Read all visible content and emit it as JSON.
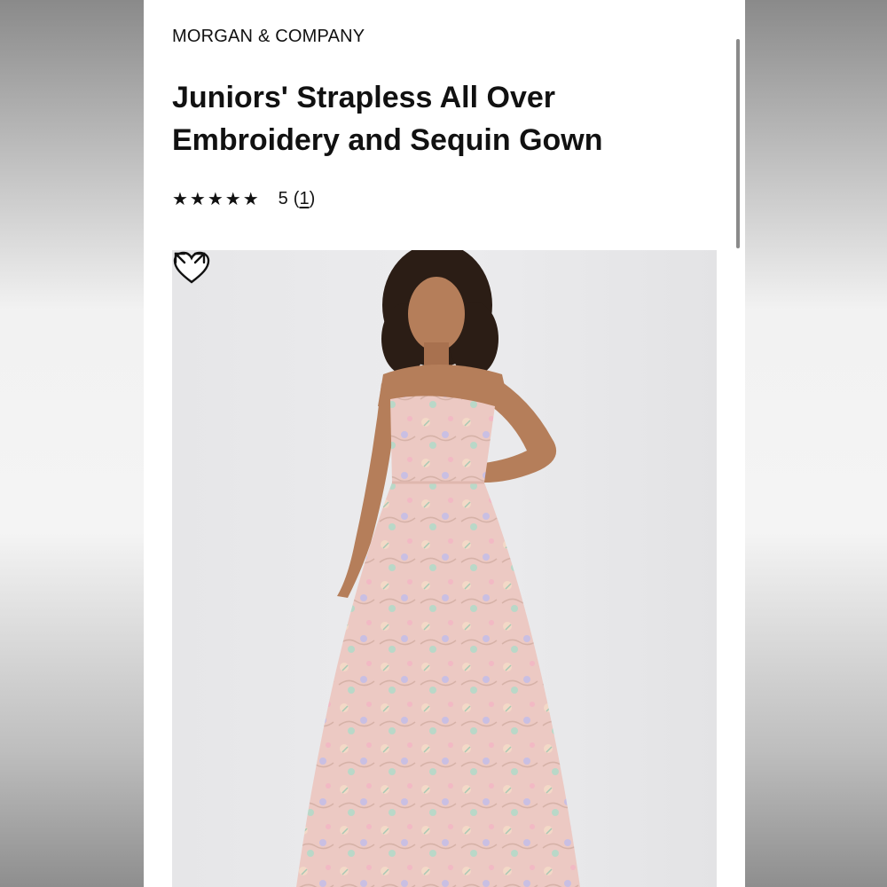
{
  "product": {
    "brand": "MORGAN & COMPANY",
    "title": "Juniors' Strapless All Over Embroidery and Sequin Gown",
    "rating": {
      "stars": "★★★★★",
      "score": "5",
      "count_prefix": "(",
      "count": "1",
      "count_suffix": ")",
      "value": 5,
      "max": 5
    }
  },
  "colors": {
    "text": "#111111",
    "background": "#ffffff",
    "dress": "#ecc9c3"
  },
  "icons": {
    "favorite": "heart-icon",
    "zoom": "expand-icon"
  }
}
